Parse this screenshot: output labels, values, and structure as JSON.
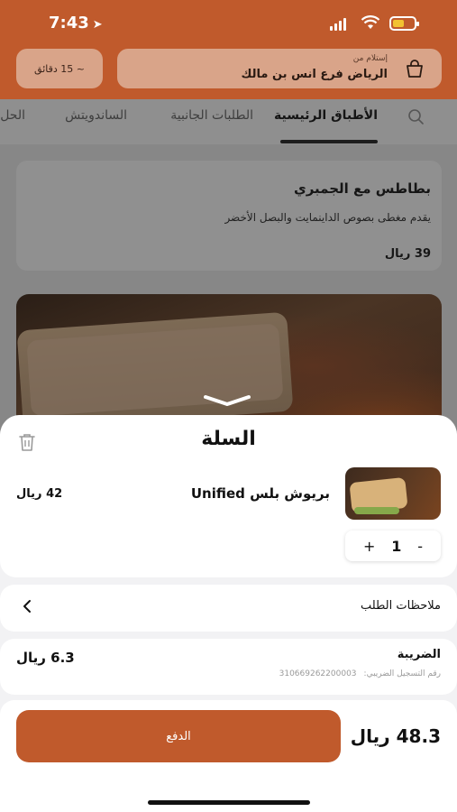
{
  "status_bar": {
    "time": "7:43",
    "location_arrow": "location-arrow-icon"
  },
  "header": {
    "eta": "~ 15 دقائق",
    "pickup_label": "إستلام من",
    "branch": "الرياض فرع انس بن مالك"
  },
  "tabs": [
    {
      "label": "الأطباق الرئيسية",
      "active": true
    },
    {
      "label": "الطلبات الجانبية"
    },
    {
      "label": "الساندويتش"
    },
    {
      "label": "الحل"
    }
  ],
  "menu": {
    "dish_name": "بطاطس مع الجمبري",
    "dish_desc": "يقدم مغطى بصوص الداينمايت والبصل الأخضر",
    "dish_price": "39 ريال"
  },
  "cart": {
    "title": "السلة",
    "item_name": "بريوش بلس Unified",
    "item_price": "42 ريال",
    "qty": "1",
    "plus": "+",
    "minus": "-",
    "notes_label": "ملاحظات الطلب",
    "tax_label": "الضريبة",
    "tax_reg_label": "رقم التسجيل الضريبي:",
    "tax_reg_number": "310669262200003",
    "tax_amount": "6.3 ريال",
    "total": "48.3 ريال",
    "pay_label": "الدفع"
  },
  "colors": {
    "brand": "#c05a2c",
    "sheet_bg": "#f2f2f4"
  }
}
